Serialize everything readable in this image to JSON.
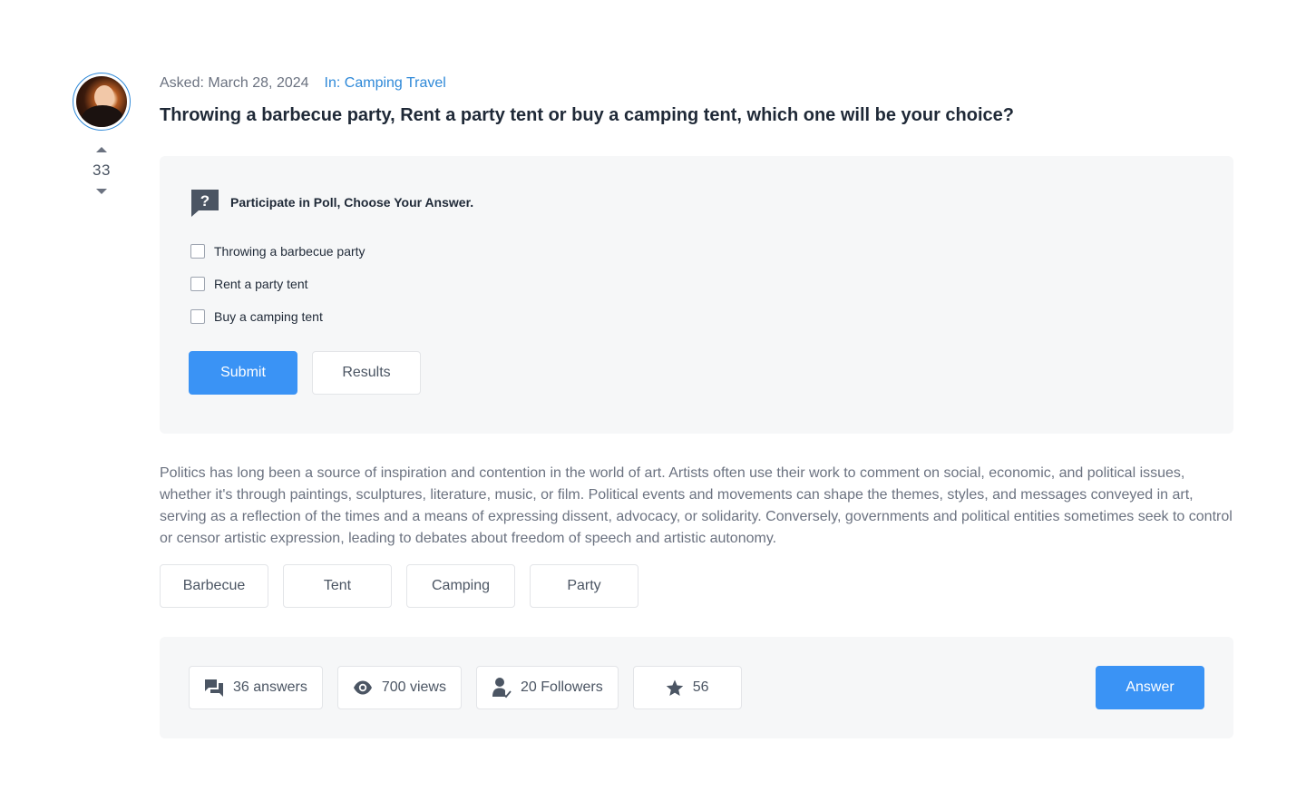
{
  "question": {
    "votes": "33",
    "asked": "Asked: March 28, 2024",
    "category": "In: Camping Travel",
    "title": "Throwing a barbecue party, Rent a party tent or buy a camping tent, which one will be your choice?",
    "body": "Politics has long been a source of inspiration and contention in the world of art. Artists often use their work to comment on social, economic, and political issues, whether it's through paintings, sculptures, literature, music, or film. Political events and movements can shape the themes, styles, and messages conveyed in art, serving as a reflection of the times and a means of expressing dissent, advocacy, or solidarity. Conversely, governments and political entities sometimes seek to control or censor artistic expression, leading to debates about freedom of speech and artistic autonomy."
  },
  "poll": {
    "heading": "Participate in Poll, Choose Your Answer.",
    "icon": "question-chat-icon",
    "options": [
      {
        "label": "Throwing a barbecue party",
        "checked": false
      },
      {
        "label": "Rent a party tent",
        "checked": false
      },
      {
        "label": "Buy a camping tent",
        "checked": false
      }
    ],
    "submit_label": "Submit",
    "results_label": "Results"
  },
  "tags": [
    "Barbecue",
    "Tent",
    "Camping",
    "Party"
  ],
  "stats": {
    "answers": "36 answers",
    "views": "700 views",
    "followers": "20 Followers",
    "favorites": "56"
  },
  "answer_label": "Answer",
  "colors": {
    "accent": "#3a93f5",
    "link": "#2f89d8",
    "panel_bg": "#f6f7f8",
    "border": "#e3e5e8",
    "icon": "#4b5563"
  }
}
